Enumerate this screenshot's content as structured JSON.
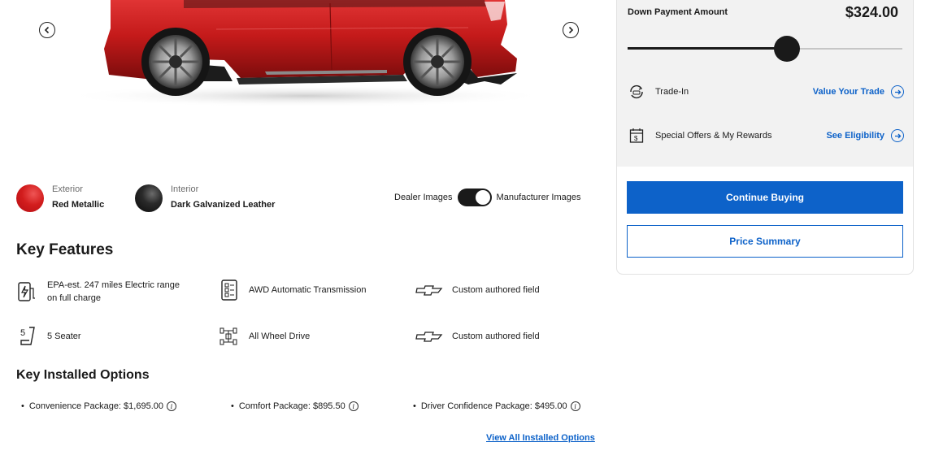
{
  "hero": {
    "vehicle_image": "red-electric-suv-side-view",
    "prev_icon": "chevron-left-icon",
    "next_icon": "chevron-right-icon"
  },
  "colors": {
    "exterior": {
      "label": "Exterior",
      "value": "Red Metallic",
      "swatch_color": "#d21d1d"
    },
    "interior": {
      "label": "Interior",
      "value": "Dark Galvanized Leather",
      "swatch_color": "#1a1a1a"
    }
  },
  "image_toggle": {
    "left_label": "Dealer Images",
    "right_label": "Manufacturer Images",
    "state": "on"
  },
  "key_features": {
    "title": "Key Features",
    "items": [
      {
        "icon": "ev-charger-icon",
        "text_line1": "EPA-est. 247 miles Electric range",
        "text_line2": "on full charge"
      },
      {
        "icon": "transmission-icon",
        "text": "AWD Automatic Transmission"
      },
      {
        "icon": "chevrolet-bowtie-icon",
        "text": "Custom authored field"
      },
      {
        "icon": "seat-icon",
        "icon_text": "5",
        "text": "5 Seater"
      },
      {
        "icon": "drivetrain-icon",
        "text": "All Wheel Drive"
      },
      {
        "icon": "chevrolet-bowtie-icon",
        "text": "Custom authored field"
      }
    ]
  },
  "installed_options": {
    "title": "Key Installed Options",
    "items": [
      {
        "text": "Convenience Package: $1,695.00"
      },
      {
        "text": "Comfort Package: $895.50"
      },
      {
        "text": "Driver Confidence Package: $495.00"
      }
    ],
    "view_all": "View All Installed Options"
  },
  "panel": {
    "down_payment_label": "Down Payment Amount",
    "down_payment_amount": "$324.00",
    "slider_fraction": 0.58,
    "trade_in": {
      "icon": "trade-in-icon",
      "label": "Trade-In",
      "link": "Value Your Trade"
    },
    "offers": {
      "icon": "dollar-calendar-icon",
      "label": "Special Offers & My Rewards",
      "link": "See Eligibility"
    },
    "continue_button": "Continue Buying",
    "summary_button": "Price Summary",
    "accent_color": "#0d62c9"
  }
}
